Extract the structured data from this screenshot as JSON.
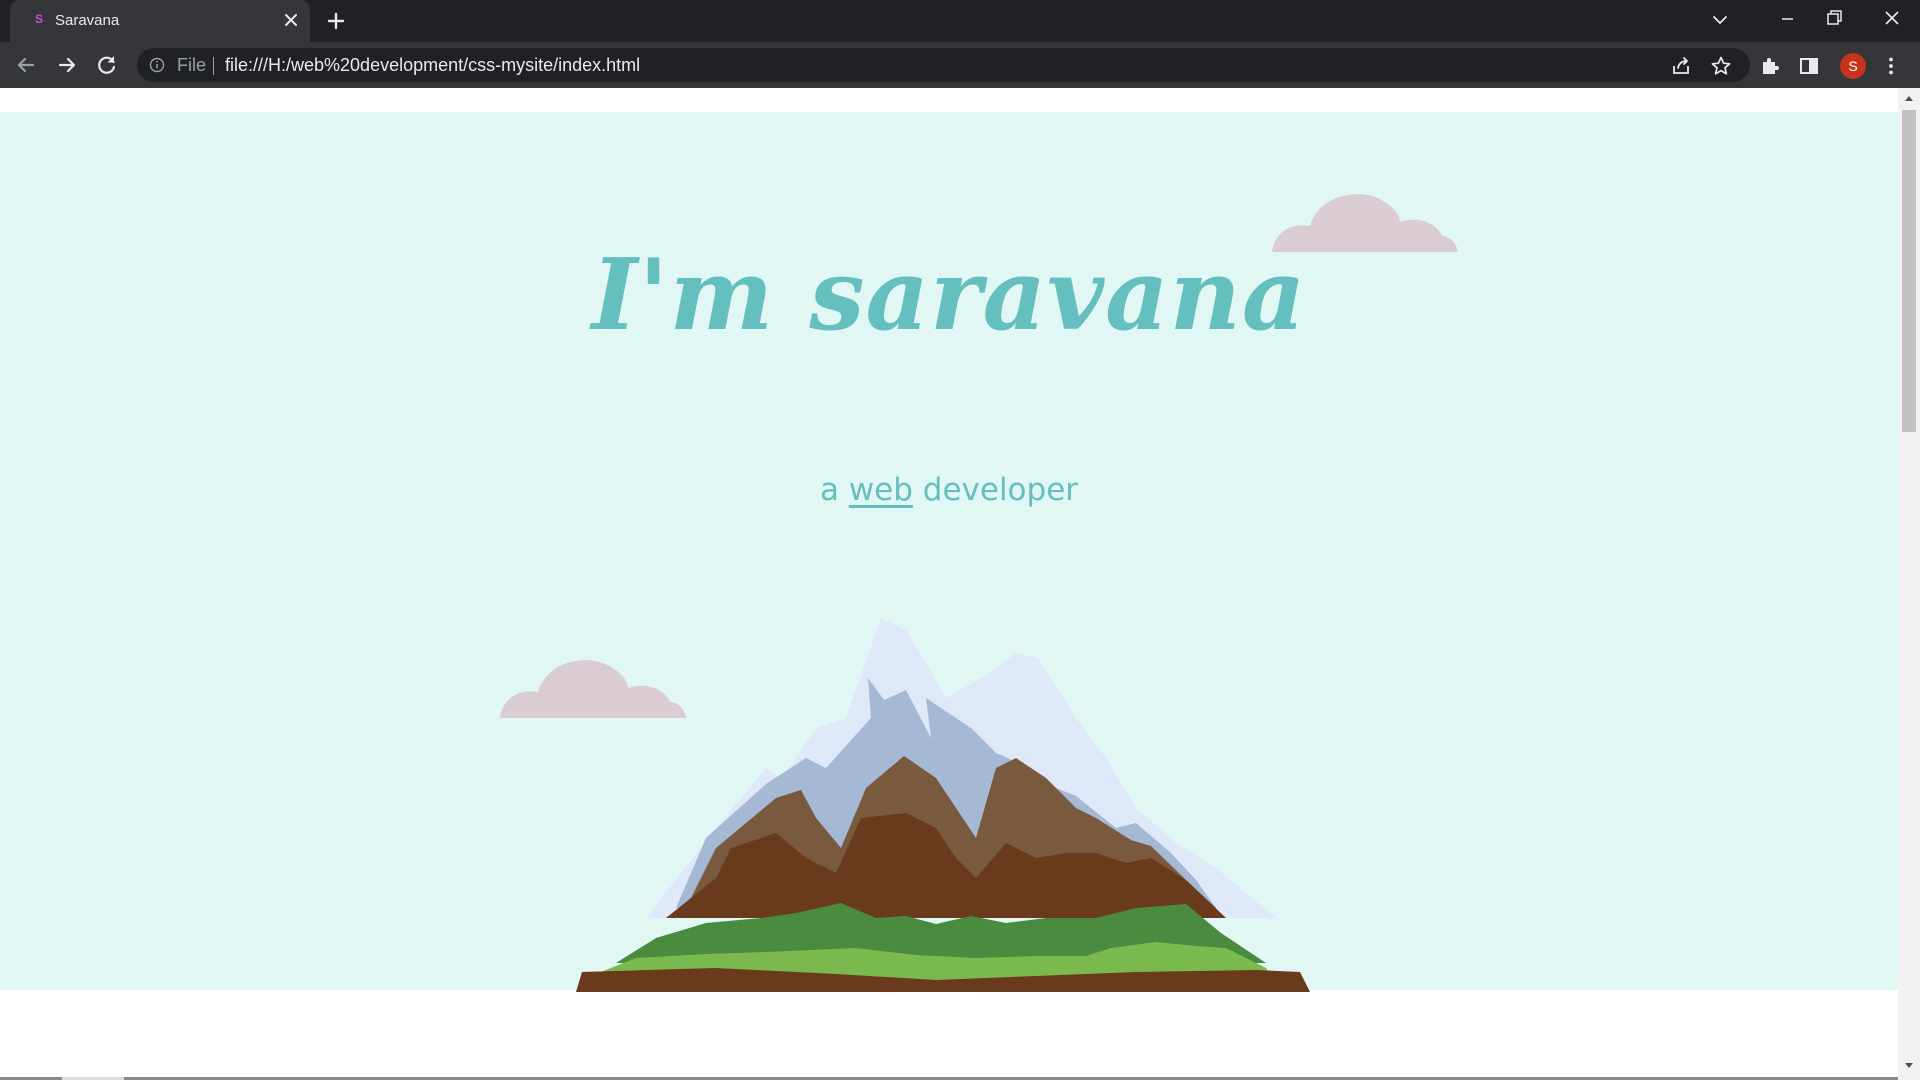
{
  "browser": {
    "tab": {
      "title": "Saravana",
      "favicon_letter": "S",
      "favicon": "saravana-favicon-icon"
    },
    "omnibox": {
      "site_chip": "File",
      "url": "file:///H:/web%20development/css-mysite/index.html"
    },
    "profile": {
      "initial": "S",
      "color": "#c5341b"
    },
    "icons": [
      "back-arrow-icon",
      "forward-arrow-icon",
      "reload-icon",
      "site-info-icon",
      "share-icon",
      "star-icon",
      "extensions-puzzle-icon",
      "side-panel-icon",
      "kebab-menu-icon",
      "tab-close-icon",
      "new-tab-plus-icon",
      "tab-search-chevron-icon",
      "minimize-icon",
      "restore-icon",
      "close-window-icon"
    ]
  },
  "page": {
    "hero": {
      "title": "I'm saravana",
      "subtitle_prefix": "a ",
      "subtitle_link": "web",
      "subtitle_suffix": " developer"
    },
    "colors": {
      "hero_bg": "#e0f7f3",
      "accent": "#66bfbf",
      "cloud": "#d9cdd3"
    }
  },
  "scroll": {
    "position_fraction": 0.0
  }
}
